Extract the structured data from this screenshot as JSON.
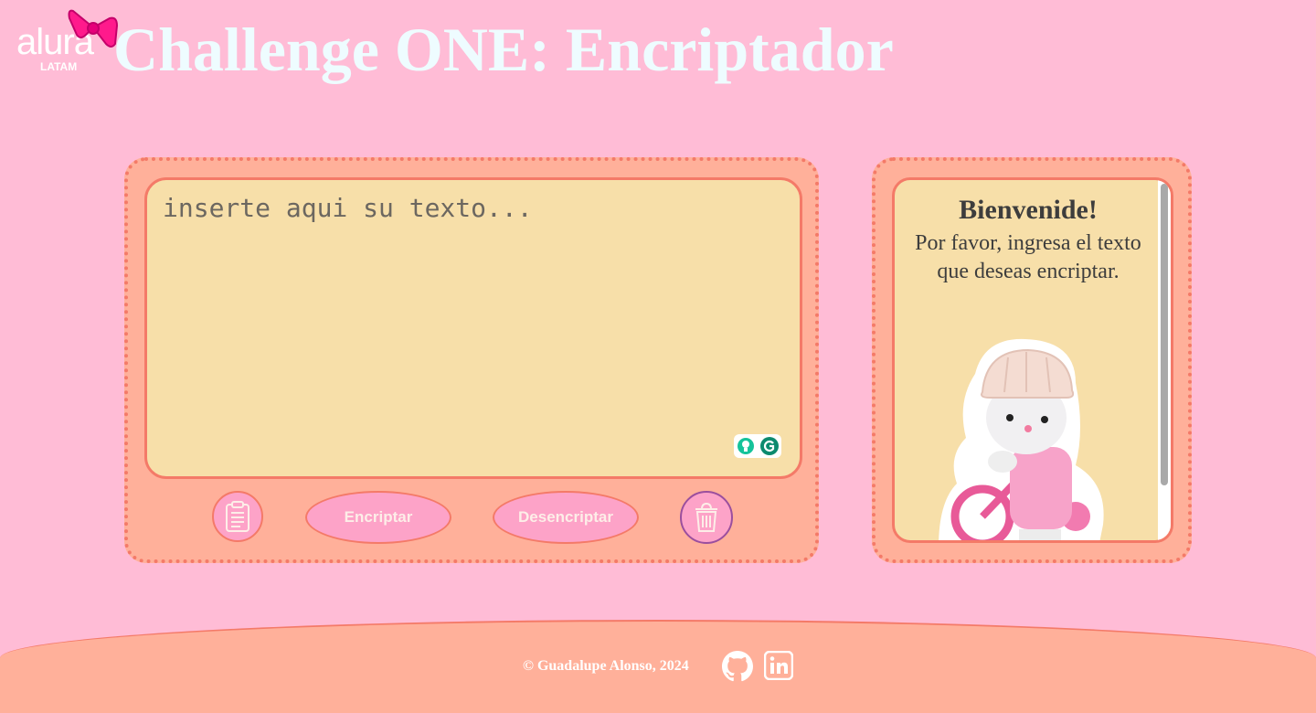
{
  "header": {
    "logo_word": "alura",
    "logo_sub": "LATAM",
    "title": "Challenge ONE: Encriptador"
  },
  "input": {
    "placeholder": "inserte aqui su texto..."
  },
  "actions": {
    "copy_icon": "clipboard-icon",
    "encrypt_label": "Encriptar",
    "decrypt_label": "Desencriptar",
    "clear_icon": "trash-icon"
  },
  "output": {
    "heading": "Bienvenide!",
    "message": "Por favor, ingresa el texto que deseas encriptar."
  },
  "footer": {
    "copyright": "© Guadalupe Alonso, 2024",
    "github_icon": "github-icon",
    "linkedin_icon": "linkedin-icon"
  },
  "colors": {
    "background": "#ffbcd6",
    "panel": "#ffb09a",
    "panel_border": "#f47a68",
    "textarea": "#f7dfa9",
    "button": "#fda3c8",
    "title": "#eefcff"
  }
}
